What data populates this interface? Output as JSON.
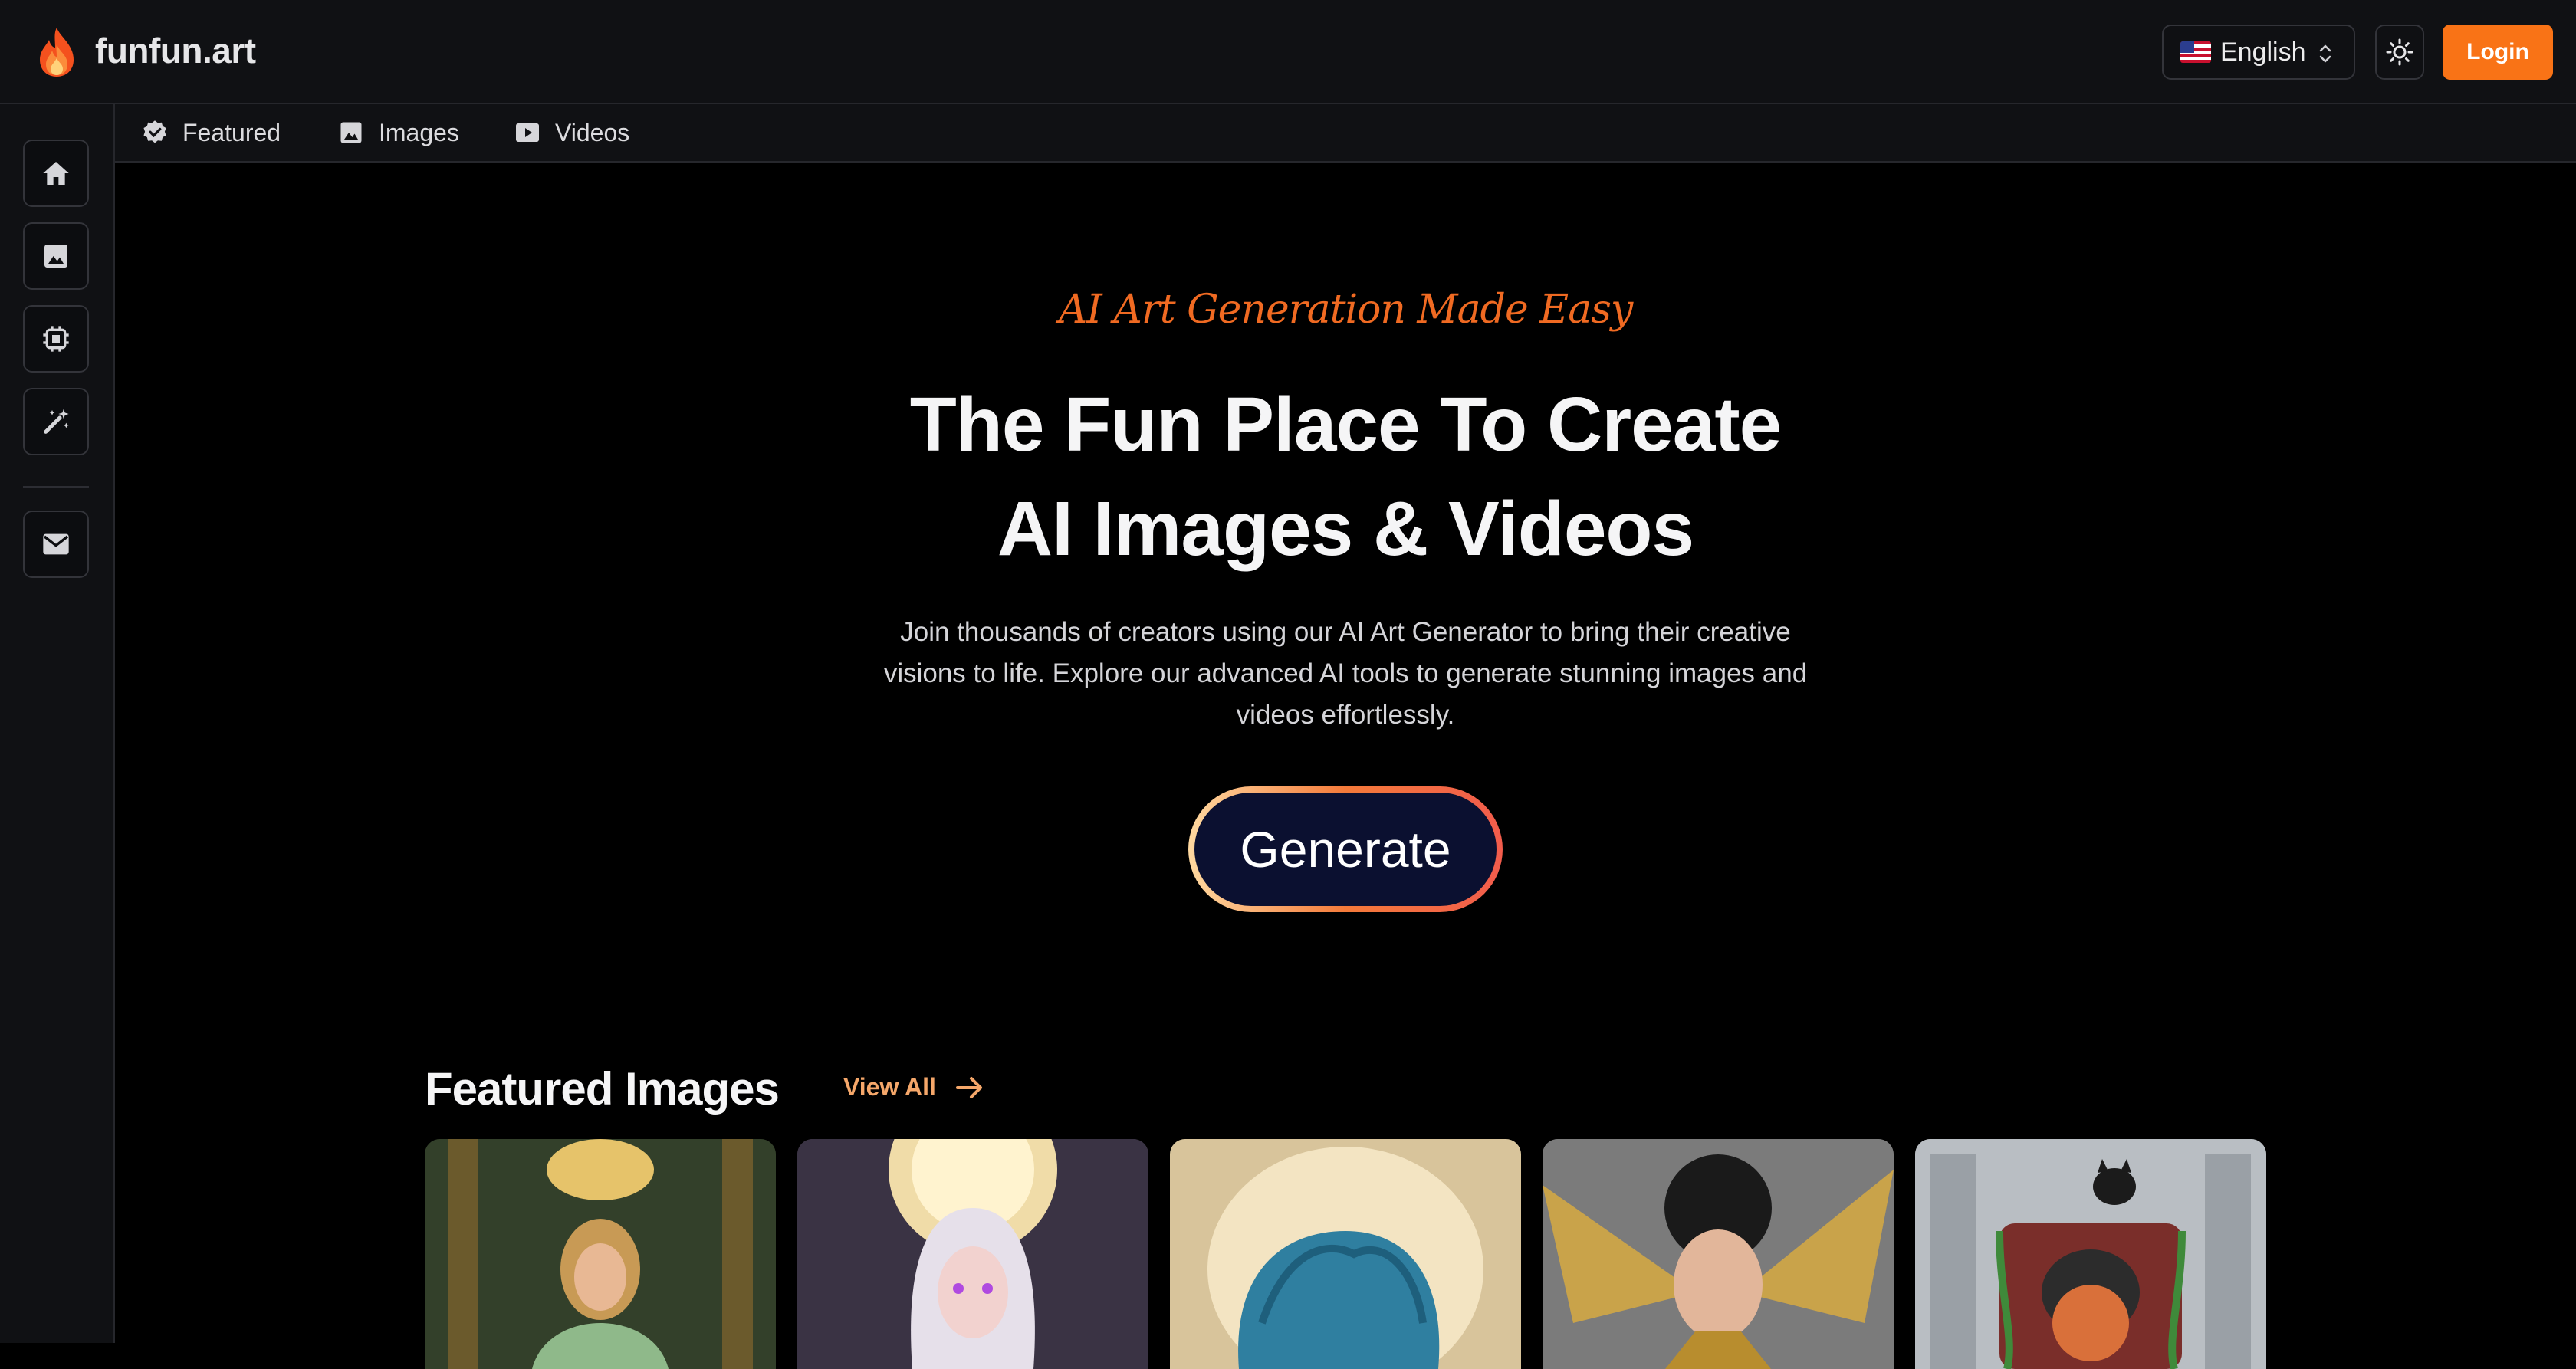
{
  "header": {
    "brand": "funfun.art",
    "language": {
      "flag": "🇺🇸",
      "label": "English"
    },
    "login_label": "Login"
  },
  "subnav": {
    "tabs": [
      {
        "label": "Featured",
        "icon": "verified-badge-icon"
      },
      {
        "label": "Images",
        "icon": "image-icon"
      },
      {
        "label": "Videos",
        "icon": "play-video-icon"
      }
    ]
  },
  "sidebar": {
    "items": [
      {
        "icon": "home-icon"
      },
      {
        "icon": "image-icon"
      },
      {
        "icon": "chip-icon"
      },
      {
        "icon": "magic-wand-icon"
      },
      {
        "icon": "mail-icon"
      }
    ]
  },
  "hero": {
    "tagline": "AI Art Generation Made Easy",
    "headline_line1": "The Fun Place To Create",
    "headline_line2": "AI Images & Videos",
    "subtitle": "Join thousands of creators using our AI Art Generator to bring their creative visions to life. Explore our advanced AI tools to generate stunning images and videos effortlessly.",
    "cta_label": "Generate"
  },
  "featured": {
    "title": "Featured Images",
    "view_all_label": "View All"
  },
  "colors": {
    "accent": "#f97316",
    "tagline": "#f06a22",
    "view_all": "#f5a76a"
  }
}
